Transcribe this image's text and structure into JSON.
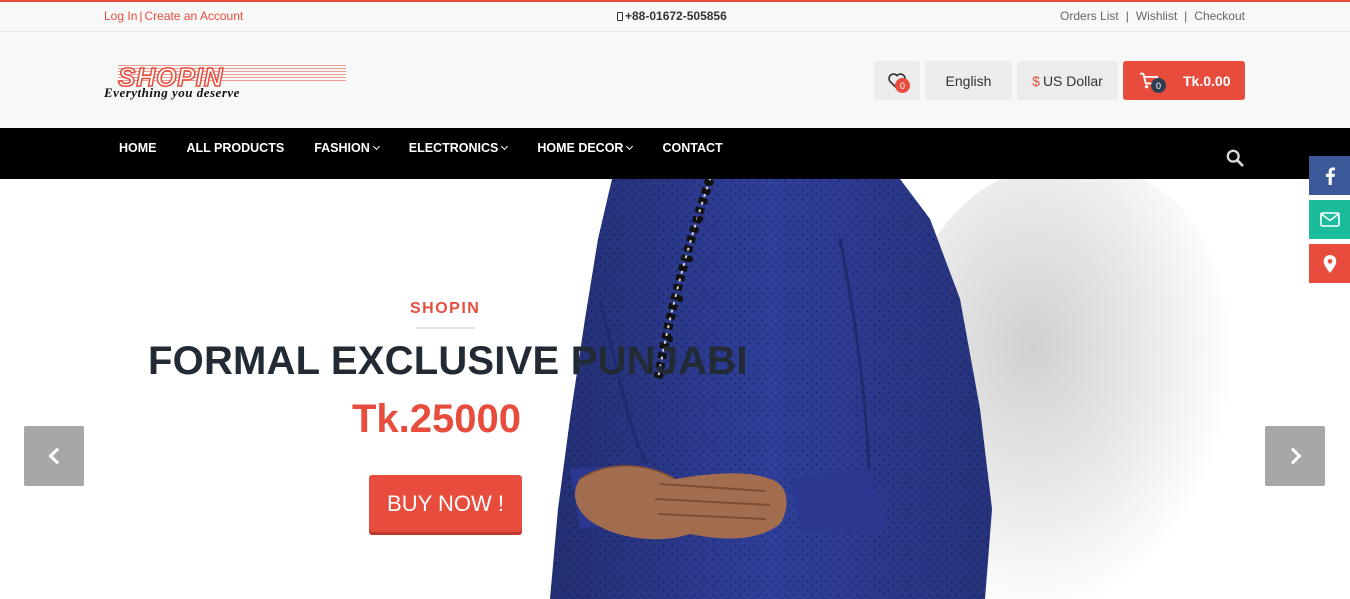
{
  "topbar": {
    "login": "Log In",
    "separator": "|",
    "create_account": "Create an Account",
    "phone": "+88-01672-505856",
    "links": [
      "Orders List",
      "Wishlist",
      "Checkout"
    ],
    "link_separator": "|"
  },
  "header": {
    "logo_word": "SHOPIN",
    "logo_tagline": "Everything you deserve",
    "wishlist_count": "0",
    "language": "English",
    "currency_symbol": "$",
    "currency": "US Dollar",
    "cart_count": "0",
    "cart_total": "Tk.0.00",
    "icons": {
      "wishlist": "heart-icon",
      "cart": "cart-icon"
    }
  },
  "nav": {
    "items": [
      {
        "label": "HOME",
        "dropdown": false
      },
      {
        "label": "ALL PRODUCTS",
        "dropdown": false
      },
      {
        "label": "FASHION",
        "dropdown": true
      },
      {
        "label": "ELECTRONICS",
        "dropdown": true
      },
      {
        "label": "HOME DECOR",
        "dropdown": true
      },
      {
        "label": "CONTACT",
        "dropdown": false
      }
    ],
    "search_icon": "search-icon"
  },
  "slider": {
    "kicker": "SHOPIN",
    "title": "FORMAL EXCLUSIVE PUNJABI",
    "price": "Tk.25000",
    "button": "BUY NOW !",
    "prev_icon": "chevron-left-icon",
    "next_icon": "chevron-right-icon"
  },
  "social": {
    "items": [
      "facebook-icon",
      "mail-icon",
      "map-pin-icon"
    ]
  },
  "colors": {
    "accent": "#e74c3c",
    "nav_bg": "#000000",
    "title": "#222a33",
    "facebook": "#3b5998",
    "mail": "#1abc9c",
    "location": "#e74c3c"
  }
}
